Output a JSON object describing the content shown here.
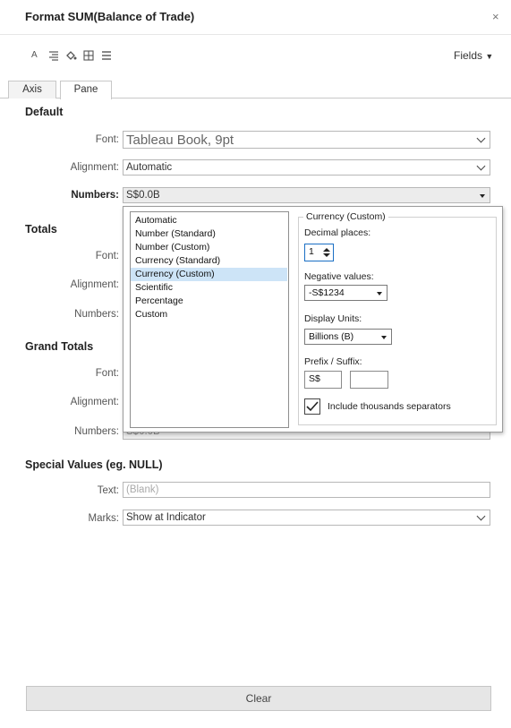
{
  "window": {
    "title": "Format SUM(Balance of Trade)",
    "close_glyph": "×"
  },
  "toolbar": {
    "icons": [
      "font-icon",
      "alignment-icon",
      "shading-icon",
      "borders-icon",
      "lines-icon"
    ],
    "fields_label": "Fields"
  },
  "tabs": [
    {
      "label": "Axis"
    },
    {
      "label": "Pane"
    }
  ],
  "default": {
    "heading": "Default",
    "font_label": "Font:",
    "font_value": "Tableau Book, 9pt",
    "alignment_label": "Alignment:",
    "alignment_value": "Automatic",
    "numbers_label": "Numbers:",
    "numbers_value": "S$0.0B"
  },
  "totals": {
    "heading": "Totals",
    "font_label": "Font:",
    "alignment_label": "Alignment:",
    "numbers_label": "Numbers:"
  },
  "grand_totals": {
    "heading": "Grand Totals",
    "font_label": "Font:",
    "alignment_label": "Alignment:",
    "numbers_label": "Numbers:",
    "numbers_value": "S$0.0B"
  },
  "number_formats": [
    "Automatic",
    "Number (Standard)",
    "Number (Custom)",
    "Currency (Standard)",
    "Currency (Custom)",
    "Scientific",
    "Percentage",
    "Custom"
  ],
  "selected_format": "Currency (Custom)",
  "currency_custom": {
    "title": "Currency (Custom)",
    "decimal_label": "Decimal places:",
    "decimal_value": "1",
    "negative_label": "Negative values:",
    "negative_value": "-S$1234",
    "units_label": "Display Units:",
    "units_value": "Billions (B)",
    "prefix_label": "Prefix / Suffix:",
    "prefix_value": "S$",
    "suffix_value": "",
    "thousands_label": "Include thousands separators",
    "thousands_checked": true
  },
  "special": {
    "heading": "Special Values (eg. NULL)",
    "text_label": "Text:",
    "text_placeholder": "(Blank)",
    "marks_label": "Marks:",
    "marks_value": "Show at Indicator"
  },
  "clear_label": "Clear"
}
